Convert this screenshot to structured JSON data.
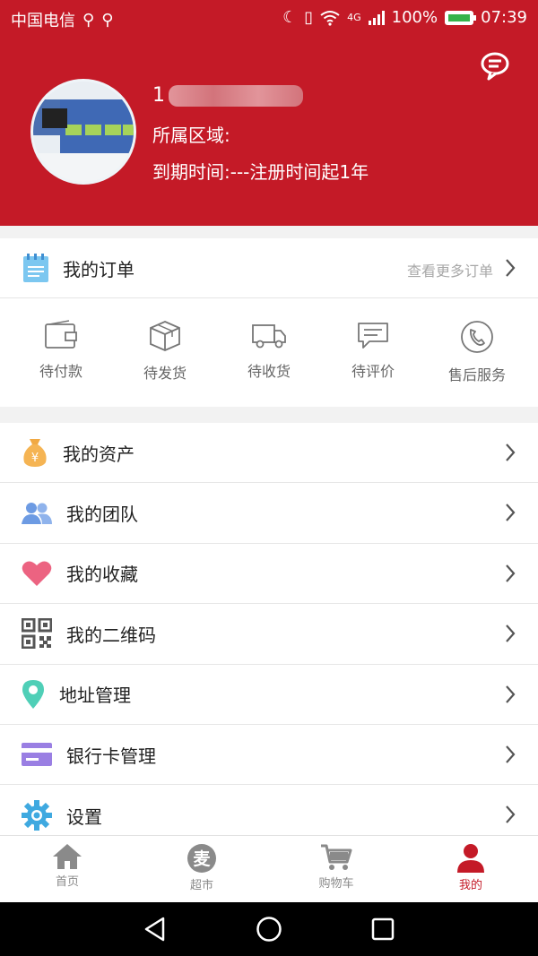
{
  "status_bar": {
    "carrier": "中国电信",
    "network": "4G",
    "battery": "100%",
    "time": "07:39"
  },
  "profile": {
    "user_id_prefix": "1",
    "region_label": "所属区域:",
    "expiry_label": "到期时间:---注册时间起1年"
  },
  "orders": {
    "title": "我的订单",
    "more": "查看更多订单",
    "items": [
      {
        "label": "待付款",
        "icon": "wallet-icon"
      },
      {
        "label": "待发货",
        "icon": "package-icon"
      },
      {
        "label": "待收货",
        "icon": "truck-icon"
      },
      {
        "label": "待评价",
        "icon": "comment-icon"
      },
      {
        "label": "售后服务",
        "icon": "phone-service-icon"
      }
    ]
  },
  "menu": [
    {
      "label": "我的资产",
      "icon": "money-bag-icon"
    },
    {
      "label": "我的团队",
      "icon": "team-icon"
    },
    {
      "label": "我的收藏",
      "icon": "heart-icon"
    },
    {
      "label": "我的二维码",
      "icon": "qr-code-icon"
    },
    {
      "label": "地址管理",
      "icon": "location-icon"
    },
    {
      "label": "银行卡管理",
      "icon": "bank-card-icon"
    },
    {
      "label": "设置",
      "icon": "gear-icon"
    }
  ],
  "tabbar": [
    {
      "label": "首页",
      "icon": "home-icon"
    },
    {
      "label": "超市",
      "icon": "mai-icon",
      "glyph": "麦"
    },
    {
      "label": "购物车",
      "icon": "cart-icon"
    },
    {
      "label": "我的",
      "icon": "user-icon",
      "active": true
    }
  ],
  "colors": {
    "brand_red": "#c41a27",
    "chevron": "#555555",
    "muted": "#8a8a8a"
  }
}
